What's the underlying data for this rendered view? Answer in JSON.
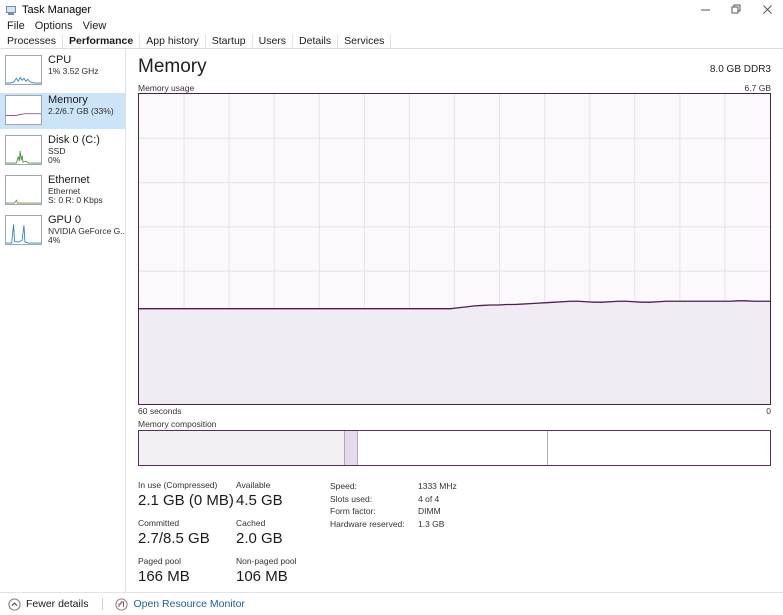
{
  "window": {
    "title": "Task Manager",
    "icon": "task-manager-icon",
    "controls": {
      "minimize": "minimize-icon",
      "restore": "restore-icon",
      "close": "close-icon"
    }
  },
  "menu": {
    "items": [
      {
        "label": "File"
      },
      {
        "label": "Options"
      },
      {
        "label": "View"
      }
    ]
  },
  "tabs": [
    {
      "label": "Processes",
      "active": false
    },
    {
      "label": "Performance",
      "active": true
    },
    {
      "label": "App history",
      "active": false
    },
    {
      "label": "Startup",
      "active": false
    },
    {
      "label": "Users",
      "active": false
    },
    {
      "label": "Details",
      "active": false
    },
    {
      "label": "Services",
      "active": false
    }
  ],
  "sidebar": {
    "items": [
      {
        "name": "cpu",
        "title": "CPU",
        "sub1": "1% 3.52 GHz",
        "sub2": "",
        "selected": false,
        "color": "#1a7fc1"
      },
      {
        "name": "memory",
        "title": "Memory",
        "sub1": "2.2/6.7 GB (33%)",
        "sub2": "",
        "selected": true,
        "color": "#7b3f8f"
      },
      {
        "name": "disk-0",
        "title": "Disk 0 (C:)",
        "sub1": "SSD",
        "sub2": "0%",
        "selected": false,
        "color": "#4a8f3c"
      },
      {
        "name": "ethernet",
        "title": "Ethernet",
        "sub1": "Ethernet",
        "sub2": "S: 0 R: 0 Kbps",
        "selected": false,
        "color": "#6b8f3c"
      },
      {
        "name": "gpu-0",
        "title": "GPU 0",
        "sub1": "NVIDIA GeForce G...",
        "sub2": "4%",
        "selected": false,
        "color": "#2f7fc1"
      }
    ]
  },
  "main": {
    "title": "Memory",
    "spec": "8.0 GB DDR3",
    "graph_label": "Memory usage",
    "graph_max_label": "6.7 GB",
    "axis_left": "60 seconds",
    "axis_right": "0",
    "composition_label": "Memory composition"
  },
  "chart_data": {
    "type": "area",
    "title": "Memory usage",
    "xlabel": "60 seconds",
    "ylabel": "6.7 GB",
    "ylim": [
      0,
      6.7
    ],
    "grid": true,
    "line_color": "#4b1f4e",
    "fill_color": "#f1ebf3",
    "values": [
      2.06,
      2.06,
      2.06,
      2.06,
      2.06,
      2.06,
      2.06,
      2.06,
      2.06,
      2.06,
      2.06,
      2.06,
      2.06,
      2.06,
      2.06,
      2.06,
      2.06,
      2.06,
      2.06,
      2.06,
      2.06,
      2.06,
      2.06,
      2.06,
      2.06,
      2.06,
      2.06,
      2.06,
      2.06,
      2.06,
      2.06,
      2.06,
      2.06,
      2.06,
      2.06,
      2.06,
      2.06,
      2.06,
      2.06,
      2.06,
      2.08,
      2.1,
      2.12,
      2.13,
      2.14,
      2.14,
      2.15,
      2.15,
      2.16,
      2.17,
      2.18,
      2.19,
      2.2,
      2.21,
      2.22,
      2.22,
      2.21,
      2.2,
      2.2,
      2.21,
      2.22,
      2.22,
      2.21,
      2.2,
      2.2,
      2.21,
      2.22,
      2.22,
      2.22,
      2.22,
      2.22,
      2.22,
      2.22,
      2.22,
      2.22,
      2.23,
      2.23,
      2.22,
      2.22,
      2.22
    ]
  },
  "composition": {
    "segments": [
      {
        "name": "in-use",
        "percent": 32.5,
        "fill": "#f2eff5"
      },
      {
        "name": "modified",
        "percent": 2.1,
        "fill": "#e3daec"
      },
      {
        "name": "standby",
        "percent": 30.0,
        "fill": "#ffffff"
      },
      {
        "name": "free",
        "percent": 35.4,
        "fill": "#ffffff"
      }
    ]
  },
  "stats": {
    "groups": [
      {
        "cells": [
          {
            "label": "In use (Compressed)",
            "value": "2.1 GB (0 MB)"
          },
          {
            "label": "Available",
            "value": "4.5 GB"
          }
        ]
      },
      {
        "cells": [
          {
            "label": "Committed",
            "value": "2.7/8.5 GB"
          },
          {
            "label": "Cached",
            "value": "2.0 GB"
          }
        ]
      },
      {
        "cells": [
          {
            "label": "Paged pool",
            "value": "166 MB"
          },
          {
            "label": "Non-paged pool",
            "value": "106 MB"
          }
        ]
      }
    ],
    "specs": [
      {
        "key": "Speed:",
        "value": "1333 MHz"
      },
      {
        "key": "Slots used:",
        "value": "4 of 4"
      },
      {
        "key": "Form factor:",
        "value": "DIMM"
      },
      {
        "key": "Hardware reserved:",
        "value": "1.3 GB"
      }
    ]
  },
  "statusbar": {
    "fewer_details": "Fewer details",
    "open_resource_monitor": "Open Resource Monitor"
  }
}
